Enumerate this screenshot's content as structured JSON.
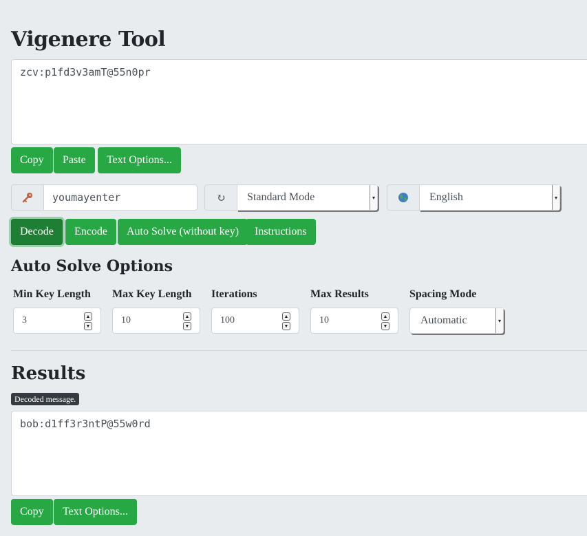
{
  "app": {
    "title": "Vigenere Tool"
  },
  "input": {
    "text": "zcv:p1fd3v3amT@55n0pr"
  },
  "input_buttons": {
    "copy": "Copy",
    "paste": "Paste",
    "text_options": "Text Options..."
  },
  "key": {
    "icon": "key-icon",
    "value": "youmayenter"
  },
  "mode": {
    "icon": "refresh-icon",
    "selected": "Standard Mode"
  },
  "language": {
    "icon": "globe-icon",
    "selected": "English"
  },
  "actions": {
    "decode": "Decode",
    "encode": "Encode",
    "auto_solve": "Auto Solve (without key)",
    "instructions": "Instructions",
    "active": "decode"
  },
  "auto_solve": {
    "heading": "Auto Solve Options",
    "min_key_length": {
      "label": "Min Key Length",
      "value": "3"
    },
    "max_key_length": {
      "label": "Max Key Length",
      "value": "10"
    },
    "iterations": {
      "label": "Iterations",
      "value": "100"
    },
    "max_results": {
      "label": "Max Results",
      "value": "10"
    },
    "spacing_mode": {
      "label": "Spacing Mode",
      "selected": "Automatic"
    }
  },
  "results": {
    "heading": "Results",
    "badge": "Decoded message.",
    "text": "bob:d1ff3r3ntP@55w0rd",
    "copy": "Copy",
    "text_options": "Text Options..."
  },
  "colors": {
    "primary": "#28a745",
    "primary_active": "#1e7e34",
    "background": "#e9ecef",
    "badge": "#343a40"
  }
}
